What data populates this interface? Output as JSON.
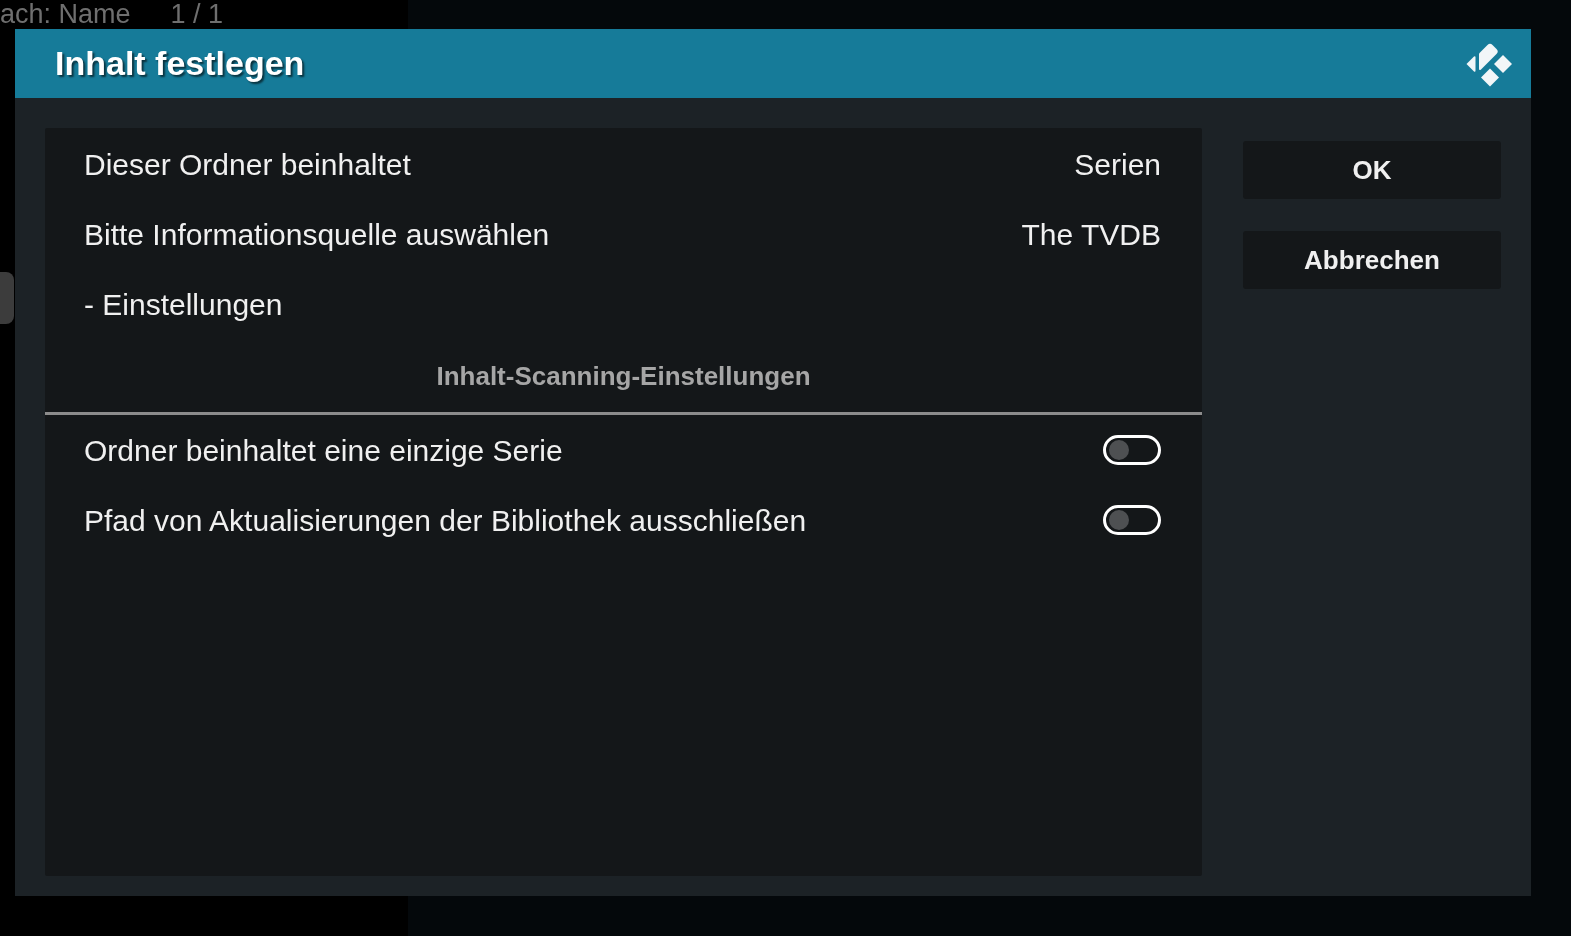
{
  "background": {
    "sort_label": "ach: Name",
    "page_count": "1 / 1"
  },
  "dialog": {
    "title": "Inhalt festlegen",
    "settings": [
      {
        "kind": "value",
        "label": "Dieser Ordner beinhaltet",
        "value": "Serien"
      },
      {
        "kind": "value",
        "label": "Bitte Informationsquelle auswählen",
        "value": "The TVDB"
      },
      {
        "kind": "action",
        "label": "- Einstellungen"
      },
      {
        "kind": "heading",
        "label": "Inhalt-Scanning-Einstellungen"
      },
      {
        "kind": "toggle",
        "label": "Ordner beinhaltet eine einzige Serie",
        "on": false
      },
      {
        "kind": "toggle",
        "label": "Pfad von Aktualisierungen der Bibliothek ausschließen",
        "on": false
      }
    ],
    "buttons": [
      "OK",
      "Abbrechen"
    ]
  }
}
